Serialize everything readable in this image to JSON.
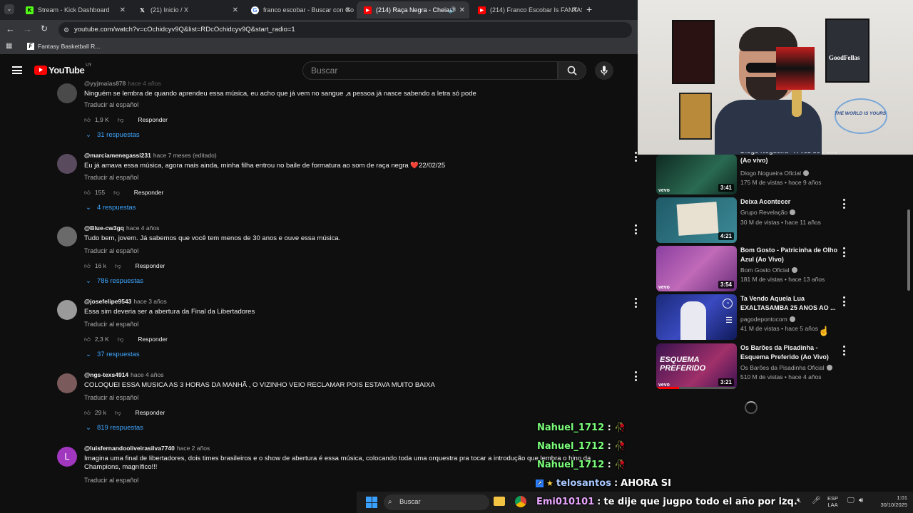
{
  "browser": {
    "tabs": [
      {
        "label": "Stream - Kick Dashboard",
        "color": "#53fc18"
      },
      {
        "label": "(21) Inicio / X",
        "color": "#000000"
      },
      {
        "label": "franco escobar - Buscar con Go",
        "color": "#4285f4"
      },
      {
        "label": "(214) Raça Negra - Cheia d",
        "color": "#ff0000"
      },
      {
        "label": "(214) Franco Escobar Is FANTAS",
        "color": "#ff0000"
      }
    ],
    "url": "youtube.com/watch?v=cOchidcyv9Q&list=RDcOchidcyv9Q&start_radio=1",
    "bookmark": "Fantasy Basketball R..."
  },
  "youtube": {
    "logo": "YouTube",
    "region": "UY",
    "search_placeholder": "Buscar"
  },
  "comments": [
    {
      "author": "@yyjmaias878",
      "time": "hace 4 años",
      "text": "Ninguém se lembra de quando aprendeu essa música, eu acho que já vem no sangue ,a pessoa já nasce sabendo a letra só pode",
      "translate": "Traducir al español",
      "likes": "1,9 K",
      "reply": "Responder",
      "replies": "31 respuestas",
      "avatar_color": "#4a4a4a"
    },
    {
      "author": "@marciamenegassi231",
      "time": "hace 7 meses (editado)",
      "text": "Eu já amava essa música, agora mais ainda, minha filha entrou no baile de formatura ao som de raça negra ❤️22/02/25",
      "translate": "Traducir al español",
      "likes": "155",
      "reply": "Responder",
      "replies": "4 respuestas",
      "avatar_color": "#5a4a5e"
    },
    {
      "author": "@Blue-cw3gq",
      "time": "hace 4 años",
      "text": "Tudo bem, jovem. Já sabemos que você tem menos de 30 anos e ouve essa música.",
      "translate": "Traducir al español",
      "likes": "16 k",
      "reply": "Responder",
      "replies": "786 respuestas",
      "avatar_color": "#6a6a6a"
    },
    {
      "author": "@josefelipe9543",
      "time": "hace 3 años",
      "text": "Essa sim deveria ser a abertura da Final da Libertadores",
      "translate": "Traducir al español",
      "likes": "2,3 K",
      "reply": "Responder",
      "replies": "37 respuestas",
      "avatar_color": "#9a9a9a"
    },
    {
      "author": "@ngs-texs4914",
      "time": "hace 4 años",
      "text": "COLOQUEI ESSA MUSICA AS 3 HORAS DA MANHÃ , O VIZINHO VEIO RECLAMAR POIS ESTAVA MUITO BAIXA",
      "translate": "Traducir al español",
      "likes": "29 k",
      "reply": "Responder",
      "replies": "819 respuestas",
      "avatar_color": "#7a5a5a"
    },
    {
      "author": "@luisfernandooliveirasilva7740",
      "time": "hace 2 años",
      "text": "Imagina uma final de libertadores, dois times brasileiros e o show de abertura é essa música, colocando toda uma orquestra pra tocar a introdução que lembra o hino da Champions, magnífico!!!",
      "translate": "Traducir al español",
      "avatar_letter": "L",
      "avatar_color": "#a136bf"
    }
  ],
  "sidebar": [
    {
      "title": "Diogo Nogueira - A Voz do Povo (Ao vivo)",
      "channel": "Diogo Nogueira Oficial",
      "meta": "175 M de vistas • hace 9 años",
      "duration": "3:41",
      "thumb": "#1d4a3a",
      "badge": "vevo"
    },
    {
      "title": "Deixa Acontecer",
      "channel": "Grupo Revelação",
      "meta": "30 M de vistas • hace 11 años",
      "duration": "4:21",
      "thumb": "#2b6a78",
      "badge": ""
    },
    {
      "title": "Bom Gosto - Patricinha de Olho Azul (Ao Vivo)",
      "channel": "Bom Gosto Oficial",
      "meta": "181 M de vistas • hace 13 años",
      "duration": "3:54",
      "thumb": "#7a3c8e",
      "badge": "vevo"
    },
    {
      "title": "Ta Vendo Aquela Lua EXALTASAMBA 25 ANOS AO ...",
      "channel": "pagodepontocom",
      "meta": "41 M de vistas • hace 5 años",
      "duration": "",
      "thumb": "#2a3a8a",
      "badge": ""
    },
    {
      "title": "Os Barões da Pisadinha - Esquema Preferido (Ao Vivo)",
      "channel": "Os Barões da Pisadinha Oficial",
      "meta": "510 M de vistas • hace 4 años",
      "duration": "3:21",
      "thumb": "#4a1a5a",
      "badge": "vevo",
      "thumb_text": "ESQUEMA PREFERIDO"
    }
  ],
  "webcam": {
    "poster_right": "GoodFellas",
    "poster_circle": "THE WORLD IS YOURS"
  },
  "chat": [
    {
      "user": "Nahuel_1712",
      "sep": ":",
      "msg": "🥀",
      "color": "#7cff7c"
    },
    {
      "user": "Nahuel_1712",
      "sep": ":",
      "msg": "🥀",
      "color": "#7cff7c"
    },
    {
      "user": "Nahuel_1712",
      "sep": ":",
      "msg": "🥀",
      "color": "#7cff7c"
    },
    {
      "user": "telosantos",
      "sep": ":",
      "msg": "AHORA SI",
      "color": "#a9c8ff"
    },
    {
      "user": "Emi010101",
      "sep": ":",
      "msg": "te dije que jugpo todo el año por izq.",
      "color": "#e9a6ff"
    }
  ],
  "taskbar": {
    "search": "Buscar",
    "lang": "ESP",
    "lang2": "LAA",
    "time": "1:01",
    "date": "30/10/2025"
  },
  "colors": {
    "accent_blue": "#3ea6ff",
    "yt_red": "#ff0000"
  }
}
